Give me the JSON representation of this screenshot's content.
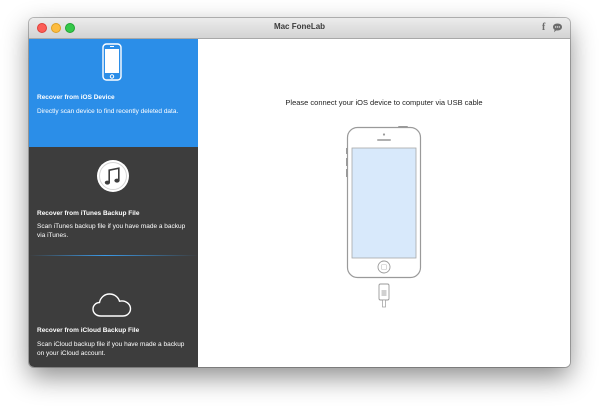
{
  "window": {
    "title": "Mac FoneLab",
    "titlebar_icons": [
      "facebook-icon",
      "chat-icon"
    ],
    "facebook_glyph": "f"
  },
  "sidebar": {
    "items": [
      {
        "title": "Recover from iOS Device",
        "description": "Directly scan device to find recently deleted data.",
        "icon": "iphone-icon",
        "active": true
      },
      {
        "title": "Recover from iTunes Backup File",
        "description": "Scan iTunes backup file if you have made a backup via iTunes.",
        "icon": "itunes-icon",
        "active": false
      },
      {
        "title": "Recover from iCloud Backup File",
        "description": "Scan iCloud backup file if you have made a backup on your iCloud account.",
        "icon": "icloud-icon",
        "active": false
      }
    ]
  },
  "main": {
    "instruction": "Please connect your iOS device to computer via USB cable",
    "illustration": "iphone-with-usb-cable"
  },
  "colors": {
    "active_panel": "#2b8ee8",
    "sidebar_bg": "#3d3d3d",
    "screen_fill": "#d8e9fb"
  }
}
